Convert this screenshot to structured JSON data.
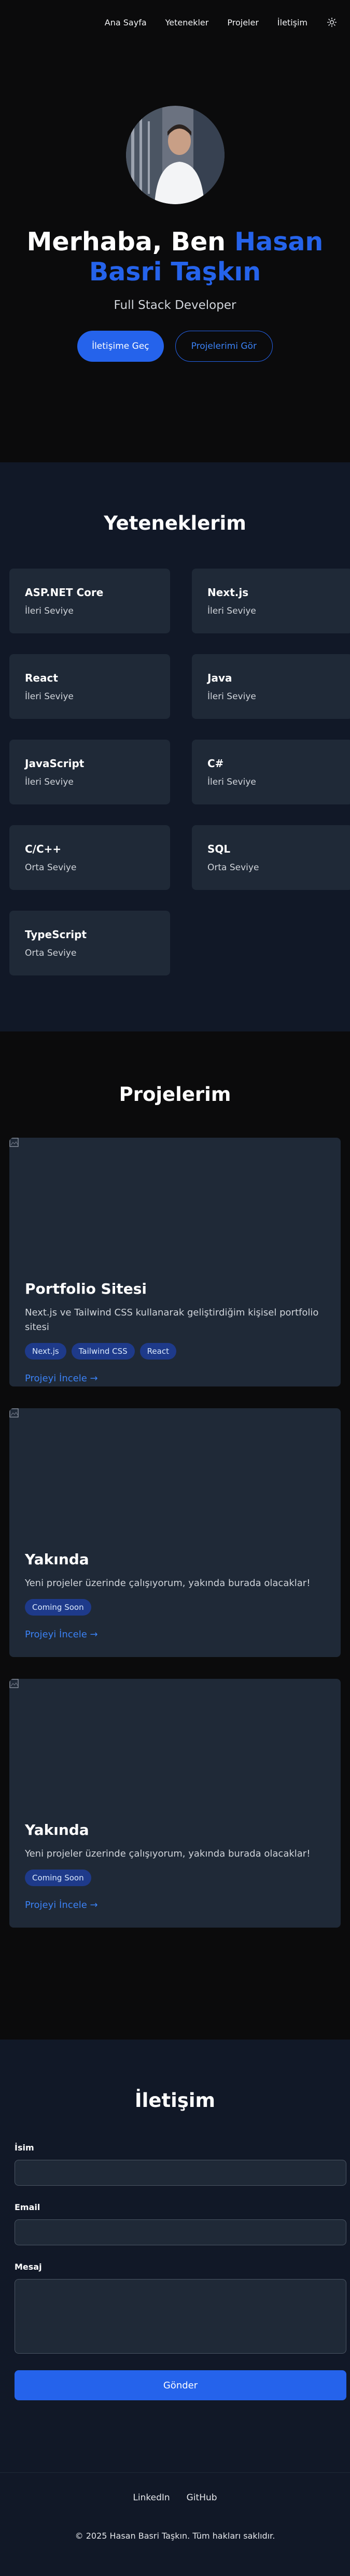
{
  "nav": {
    "items": [
      "Ana Sayfa",
      "Yetenekler",
      "Projeler",
      "İletişim"
    ],
    "theme_icon": "sun-icon"
  },
  "hero": {
    "greeting": "Merhaba, Ben ",
    "name": "Hasan Basri Taşkın",
    "role": "Full Stack Developer",
    "primary_button": "İletişime Geç",
    "secondary_button": "Projelerimi Gör",
    "accent_color": "#2563eb"
  },
  "skills": {
    "title": "Yeteneklerim",
    "items": [
      {
        "name": "ASP.NET Core",
        "level": "İleri Seviye"
      },
      {
        "name": "Next.js",
        "level": "İleri Seviye"
      },
      {
        "name": "React",
        "level": "İleri Seviye"
      },
      {
        "name": "Java",
        "level": "İleri Seviye"
      },
      {
        "name": "JavaScript",
        "level": "İleri Seviye"
      },
      {
        "name": "C#",
        "level": "İleri Seviye"
      },
      {
        "name": "C/C++",
        "level": "Orta Seviye"
      },
      {
        "name": "SQL",
        "level": "Orta Seviye"
      },
      {
        "name": "TypeScript",
        "level": "Orta Seviye"
      }
    ]
  },
  "projects": {
    "title": "Projelerim",
    "items": [
      {
        "title": "Portfolio Sitesi",
        "description": "Next.js ve Tailwind CSS kullanarak geliştirdiğim kişisel portfolio sitesi",
        "tags": [
          "Next.js",
          "Tailwind CSS",
          "React"
        ],
        "link": "Projeyi İncele →"
      },
      {
        "title": "Yakında",
        "description": "Yeni projeler üzerinde çalışıyorum, yakında burada olacaklar!",
        "tags": [
          "Coming Soon"
        ],
        "link": "Projeyi İncele →"
      },
      {
        "title": "Yakında",
        "description": "Yeni projeler üzerinde çalışıyorum, yakında burada olacaklar!",
        "tags": [
          "Coming Soon"
        ],
        "link": "Projeyi İncele →"
      }
    ]
  },
  "contact": {
    "title": "İletişim",
    "name_label": "İsim",
    "email_label": "Email",
    "message_label": "Mesaj",
    "submit": "Gönder"
  },
  "footer": {
    "links": [
      "LinkedIn",
      "GitHub"
    ],
    "copyright": "© 2025 Hasan Basri Taşkın. Tüm hakları saklıdır."
  }
}
